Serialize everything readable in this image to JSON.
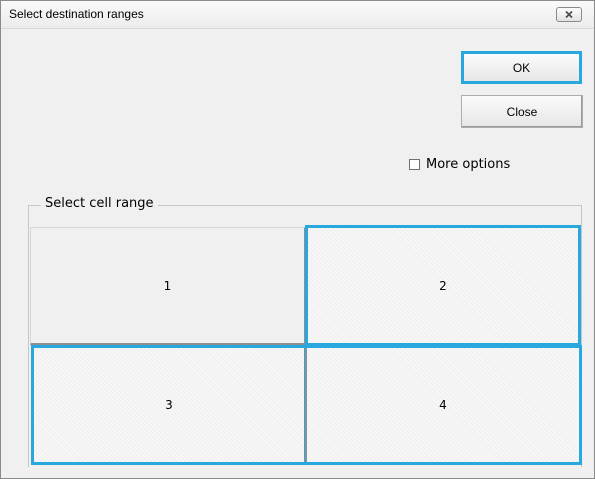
{
  "window": {
    "title": "Select destination ranges",
    "close_icon": "close-icon"
  },
  "buttons": {
    "ok_label": "OK",
    "close_label": "Close"
  },
  "options": {
    "more_options_label": "More options",
    "more_options_checked": false
  },
  "group": {
    "legend": "Select cell range",
    "cells": [
      {
        "label": "1",
        "selected": false
      },
      {
        "label": "2",
        "selected": true
      },
      {
        "label": "3",
        "selected": true
      },
      {
        "label": "4",
        "selected": true
      }
    ]
  },
  "colors": {
    "selection": "#29a8e0",
    "dialog_background": "#f0f0f0"
  }
}
